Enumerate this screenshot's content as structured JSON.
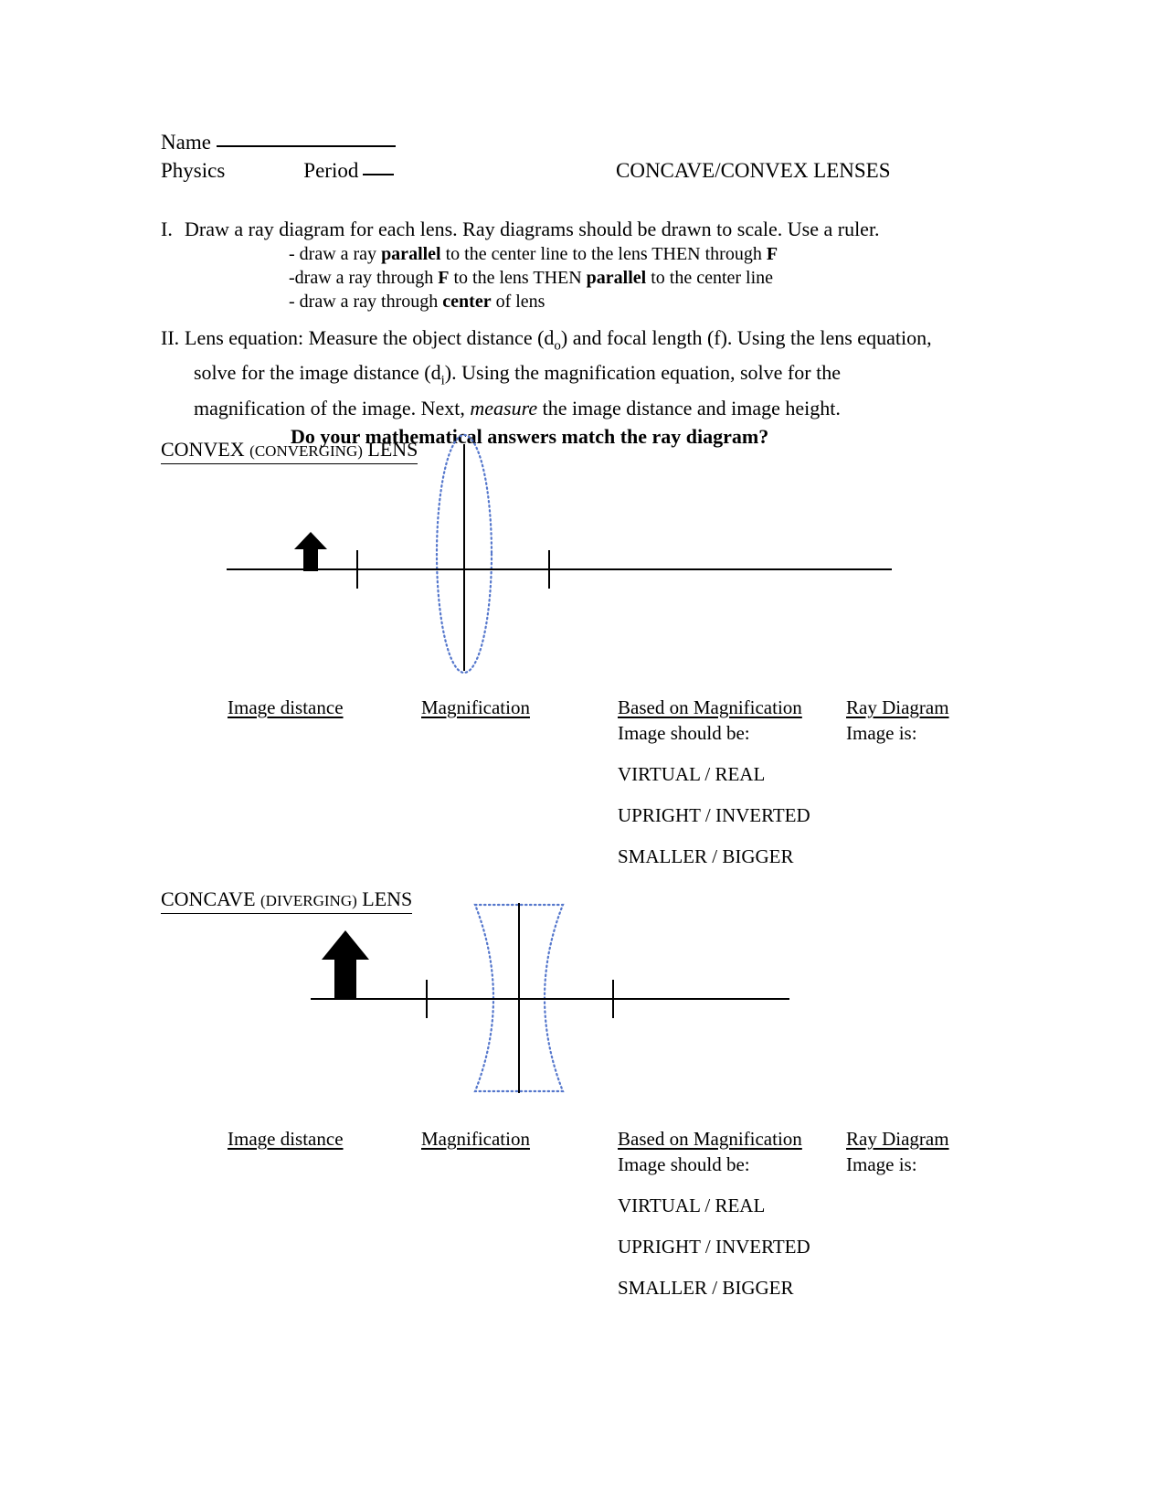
{
  "header": {
    "name_label": "Name",
    "course_label": "Physics",
    "period_label": "Period",
    "title": "CONCAVE/CONVEX LENSES"
  },
  "sections": [
    {
      "number": "I.",
      "heading": "Draw a ray diagram for each lens. Ray diagrams should be drawn to scale.  Use a ruler.",
      "bullets": [
        {
          "pre": "- draw a ray ",
          "bold1": "parallel",
          "mid": " to the center line to the lens THEN through ",
          "bold2": "F",
          "post": ""
        },
        {
          "pre": "-draw a ray through ",
          "bold1": "F",
          "mid": " to the lens THEN ",
          "bold2": "parallel",
          "post": " to the center line"
        },
        {
          "pre": "- draw a ray through ",
          "bold1": "center",
          "mid": " of lens",
          "bold2": "",
          "post": ""
        }
      ]
    },
    {
      "number": "II.",
      "line1_a": "Lens equation: Measure the object distance (d",
      "line1_sub": "o",
      "line1_b": ") and focal length (f).  Using the lens equation,",
      "line2_a": "solve for the image distance (d",
      "line2_sub": "i",
      "line2_b": ").  Using the magnification equation, solve for the",
      "line3_a": "magnification of the image.  Next, ",
      "line3_italic": "measure",
      "line3_b": " the image distance and image height.",
      "question": "Do your mathematical answers match the ray diagram?"
    }
  ],
  "diagrams": [
    {
      "label_main": "CONVEX",
      "label_paren": "(CONVERGING)",
      "label_tail": "LENS",
      "lens_type": "biconvex",
      "lens_color": "#5577CC",
      "object_arrow": "upward-arrow"
    },
    {
      "label_main": "CONCAVE",
      "label_paren": "(DIVERGING)",
      "label_tail": "LENS",
      "lens_type": "biconcave",
      "lens_color": "#5577CC",
      "object_arrow": "upward-arrow"
    }
  ],
  "answer_labels": {
    "image_distance": "Image distance",
    "magnification": "Magnification",
    "based_on_magnification": "Based on Magnification",
    "image_should_be": "Image should be:",
    "ray_diagram": "Ray Diagram",
    "image_is": "Image is:",
    "choices": [
      "VIRTUAL / REAL",
      "UPRIGHT / INVERTED",
      "SMALLER / BIGGER"
    ]
  }
}
